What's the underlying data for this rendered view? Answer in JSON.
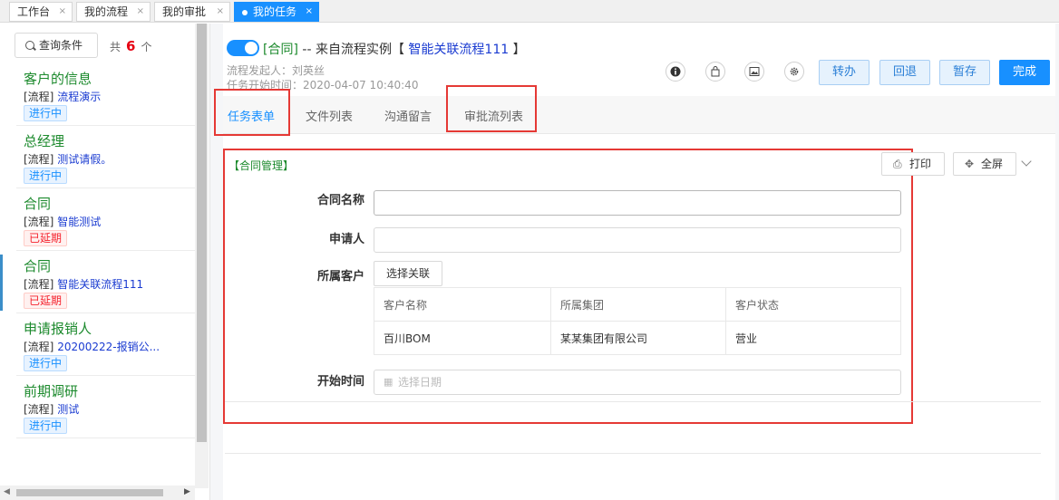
{
  "top_tabs": [
    {
      "label": "工作台"
    },
    {
      "label": "我的流程"
    },
    {
      "label": "我的审批"
    },
    {
      "label": "我的任务"
    }
  ],
  "left": {
    "query_label": "查询条件",
    "total_prefix": "共",
    "total_count": "6",
    "total_suffix": "个",
    "items": [
      {
        "title": "客户的信息",
        "prefix": "[流程]",
        "flow": "流程演示",
        "status": "进行中"
      },
      {
        "title": "总经理",
        "prefix": "[流程]",
        "flow": "测试请假。",
        "status": "进行中"
      },
      {
        "title": "合同",
        "prefix": "[流程]",
        "flow": "智能测试",
        "status": "已延期"
      },
      {
        "title": "合同",
        "prefix": "[流程]",
        "flow": "智能关联流程111",
        "status": "已延期"
      },
      {
        "title": "申请报销人",
        "prefix": "[流程]",
        "flow": "20200222-报销公...",
        "status": "进行中"
      },
      {
        "title": "前期调研",
        "prefix": "[流程]",
        "flow": "测试",
        "status": "进行中"
      }
    ]
  },
  "header": {
    "tag": "[合同]",
    "from_text": " -- 来自流程实例【 ",
    "link": "智能关联流程111",
    "close_bracket": " 】",
    "initiator": "流程发起人：刘英丝",
    "start_time": "任务开始时间：2020-04-07 10:40:40",
    "actions": [
      "转办",
      "回退",
      "暂存",
      "完成"
    ]
  },
  "tabs": [
    "任务表单",
    "文件列表",
    "沟通留言",
    "审批流列表"
  ],
  "form": {
    "section_title": "【合同管理】",
    "print_label": "打印",
    "fullscreen_label": "全屏",
    "contract_name_label": "合同名称",
    "applicant_label": "申请人",
    "customer_label": "所属客户",
    "select_button": "选择关联",
    "table_headers": [
      "客户名称",
      "所属集团",
      "客户状态"
    ],
    "table_rows": [
      [
        "百川BOM",
        "某某集团有限公司",
        "营业"
      ]
    ],
    "start_time_label": "开始时间",
    "date_placeholder": "选择日期"
  }
}
